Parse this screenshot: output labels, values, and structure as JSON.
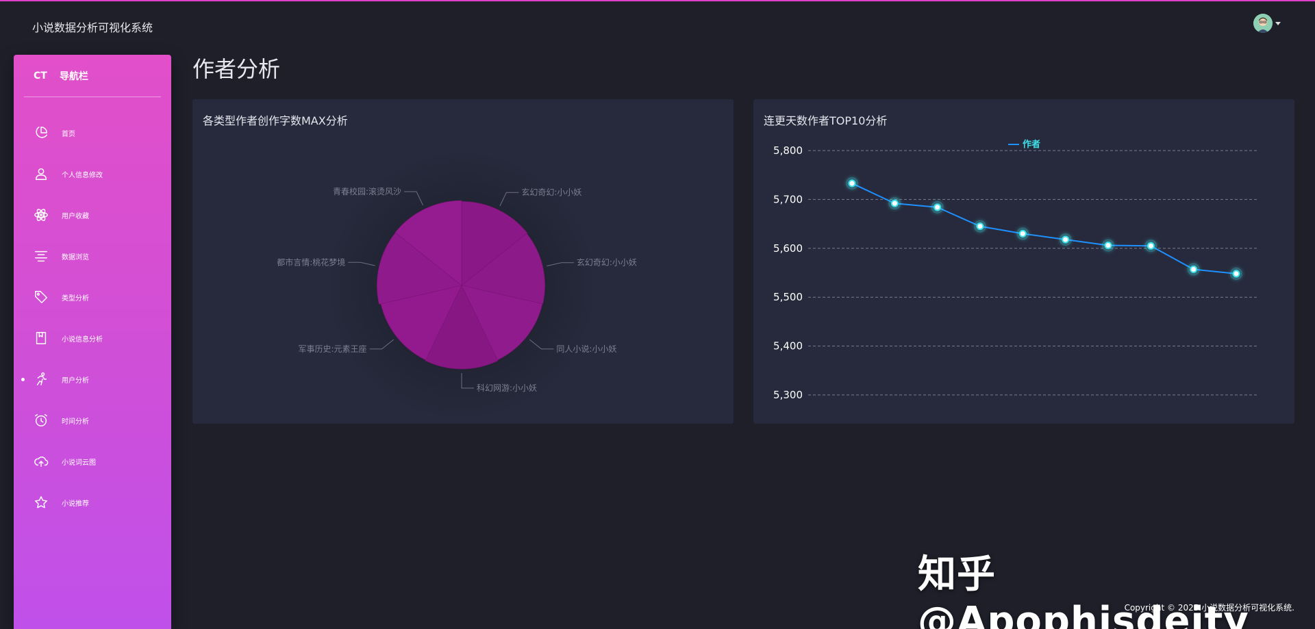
{
  "app": {
    "title": "小说数据分析可视化系统"
  },
  "sidebar": {
    "logo": "CT",
    "title": "导航栏",
    "items": [
      {
        "label": "首页",
        "icon": "pie-chart-icon",
        "active": false
      },
      {
        "label": "个人信息修改",
        "icon": "user-icon",
        "active": false
      },
      {
        "label": "用户收藏",
        "icon": "atom-icon",
        "active": false
      },
      {
        "label": "数据浏览",
        "icon": "align-center-icon",
        "active": false
      },
      {
        "label": "类型分析",
        "icon": "tag-icon",
        "active": false
      },
      {
        "label": "小说信息分析",
        "icon": "book-icon",
        "active": false
      },
      {
        "label": "用户分析",
        "icon": "running-icon",
        "active": true
      },
      {
        "label": "时间分析",
        "icon": "alarm-clock-icon",
        "active": false
      },
      {
        "label": "小说词云图",
        "icon": "cloud-upload-icon",
        "active": false
      },
      {
        "label": "小说推荐",
        "icon": "star-icon",
        "active": false
      }
    ]
  },
  "page": {
    "title": "作者分析"
  },
  "watermark": "知乎 @Apophisdeity",
  "copyright": "Copyright © 2025.小说数据分析可视化系统.",
  "colors": {
    "accent": "#e040c8",
    "pie": "#8e1a8a",
    "line": "#1e90ff",
    "point_glow": "#3fe0e8"
  },
  "chart_data": [
    {
      "type": "pie",
      "style": "rose",
      "title": "各类型作者创作字数MAX分析",
      "categories": [
        "玄幻奇幻:小小妖",
        "玄幻奇幻:小小妖",
        "同人小说:小小妖",
        "科幻网游:小小妖",
        "军事历史:元素王座",
        "都市言情:桃花梦境",
        "青春校园:滚烫风沙"
      ],
      "values": [
        118,
        113,
        110,
        115,
        110,
        122,
        124
      ]
    },
    {
      "type": "line",
      "title": "连更天数作者TOP10分析",
      "legend": [
        "作者"
      ],
      "legend_position": "top-center",
      "ylim": [
        5300,
        5800
      ],
      "yticks": [
        "5,300",
        "5,400",
        "5,500",
        "5,600",
        "5,700",
        "5,800"
      ],
      "grid": true,
      "series": [
        {
          "name": "作者",
          "values": [
            5733,
            5692,
            5684,
            5645,
            5630,
            5618,
            5606,
            5605,
            5557,
            5548
          ]
        }
      ]
    }
  ]
}
